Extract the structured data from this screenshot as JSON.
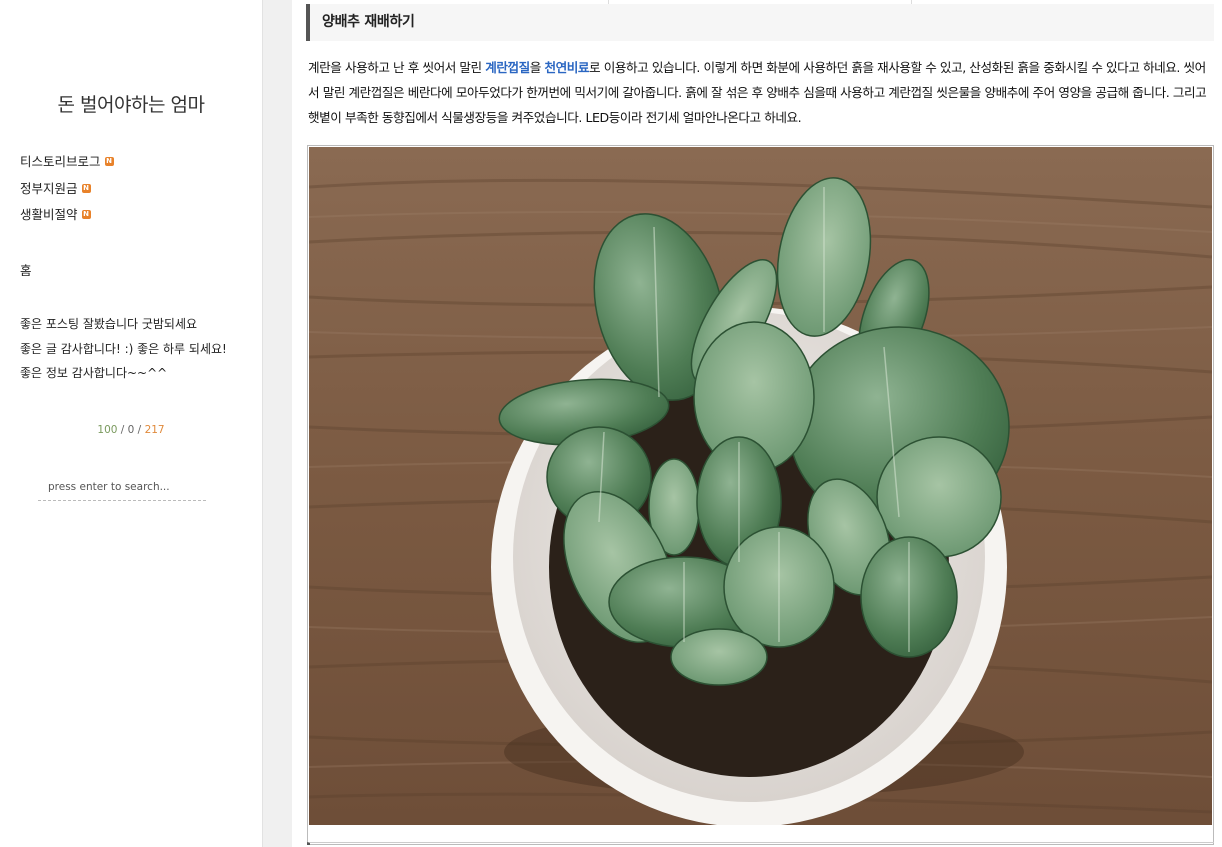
{
  "sidebar": {
    "blog_title": "돈 벌어야하는 엄마",
    "categories": [
      {
        "label": "티스토리브로그",
        "badge": "N"
      },
      {
        "label": "정부지원금",
        "badge": "N"
      },
      {
        "label": "생활비절약",
        "badge": "N"
      }
    ],
    "home_label": "홈",
    "recent_comments": [
      "좋은 포스팅 잘봤습니다 굿밤되세요",
      "좋은 글 감사합니다! :) 좋은 하루 되세요!",
      "좋은 정보 감사합니다~~^^"
    ],
    "visitor_counter": {
      "total": "100",
      "sep1": " / ",
      "today": "0",
      "sep2": " / ",
      "yesterday": "217"
    },
    "search": {
      "placeholder": "press enter to search..."
    }
  },
  "post": {
    "section_heading": "양배추 재배하기",
    "paragraph": {
      "part1": "계란을 사용하고 난 후 씻어서 말린 ",
      "link1": "계란껍질",
      "part2": "을 ",
      "link2": "천연비료",
      "part3": "로 이용하고 있습니다. 이렇게 하면 화분에 사용하던 흙을 재사용할 수 있고, 산성화된 흙을 중화시킬 수 있다고 하네요. 씻어서 말린 계란껍질은 베란다에 모아두었다가 한꺼번에 믹서기에 갈아줍니다. 흙에 잘 섞은 후 양배추 심을때 사용하고 계란껍질 씻은물을 양배추에 주어 영양을 공급해 줍니다. 그리고 햇볕이 부족한 동향집에서 식물생장등을 켜주었습니다. LED등이라 전기세 얼마안나온다고 하네요."
    },
    "image": {
      "subject": "cabbage-seedlings-in-white-bowl-photo"
    }
  },
  "colors": {
    "link": "#2a66c2",
    "badge": "#e8822a",
    "counter_total": "#7a9a5e",
    "counter_yesterday": "#e08a3c",
    "gutter": "#f0f0f0",
    "heading_bg": "#f6f6f6"
  }
}
